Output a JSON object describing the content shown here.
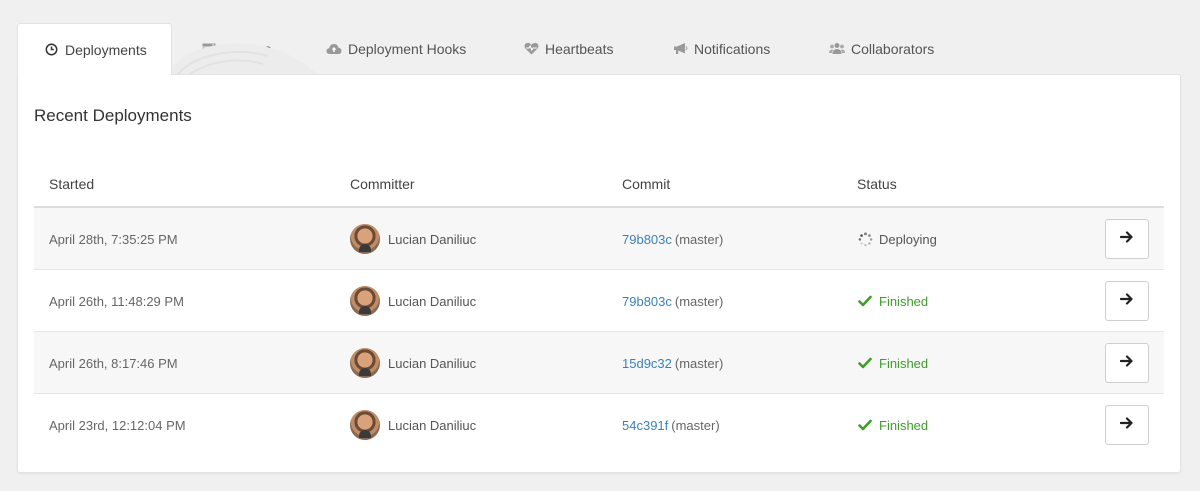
{
  "tabs": [
    {
      "label": "Deployments",
      "icon": "clock-icon",
      "active": true
    },
    {
      "label": "Servers",
      "icon": "server-icon",
      "active": false
    },
    {
      "label": "Deployment Hooks",
      "icon": "cloud-upload-icon",
      "active": false
    },
    {
      "label": "Heartbeats",
      "icon": "heartbeat-icon",
      "active": false
    },
    {
      "label": "Notifications",
      "icon": "megaphone-icon",
      "active": false
    },
    {
      "label": "Collaborators",
      "icon": "users-icon",
      "active": false
    }
  ],
  "section_title": "Recent Deployments",
  "table": {
    "headers": {
      "started": "Started",
      "committer": "Committer",
      "commit": "Commit",
      "status": "Status"
    },
    "rows": [
      {
        "started": "April 28th, 7:35:25 PM",
        "committer": "Lucian Daniliuc",
        "commit_hash": "79b803c",
        "branch": "(master)",
        "status": "Deploying",
        "status_type": "deploying"
      },
      {
        "started": "April 26th, 11:48:29 PM",
        "committer": "Lucian Daniliuc",
        "commit_hash": "79b803c",
        "branch": "(master)",
        "status": "Finished",
        "status_type": "finished"
      },
      {
        "started": "April 26th, 8:17:46 PM",
        "committer": "Lucian Daniliuc",
        "commit_hash": "15d9c32",
        "branch": "(master)",
        "status": "Finished",
        "status_type": "finished"
      },
      {
        "started": "April 23rd, 12:12:04 PM",
        "committer": "Lucian Daniliuc",
        "commit_hash": "54c391f",
        "branch": "(master)",
        "status": "Finished",
        "status_type": "finished"
      }
    ]
  },
  "colors": {
    "link": "#3a82b6",
    "success": "#3f9e2a",
    "background": "#f0f0f0"
  }
}
